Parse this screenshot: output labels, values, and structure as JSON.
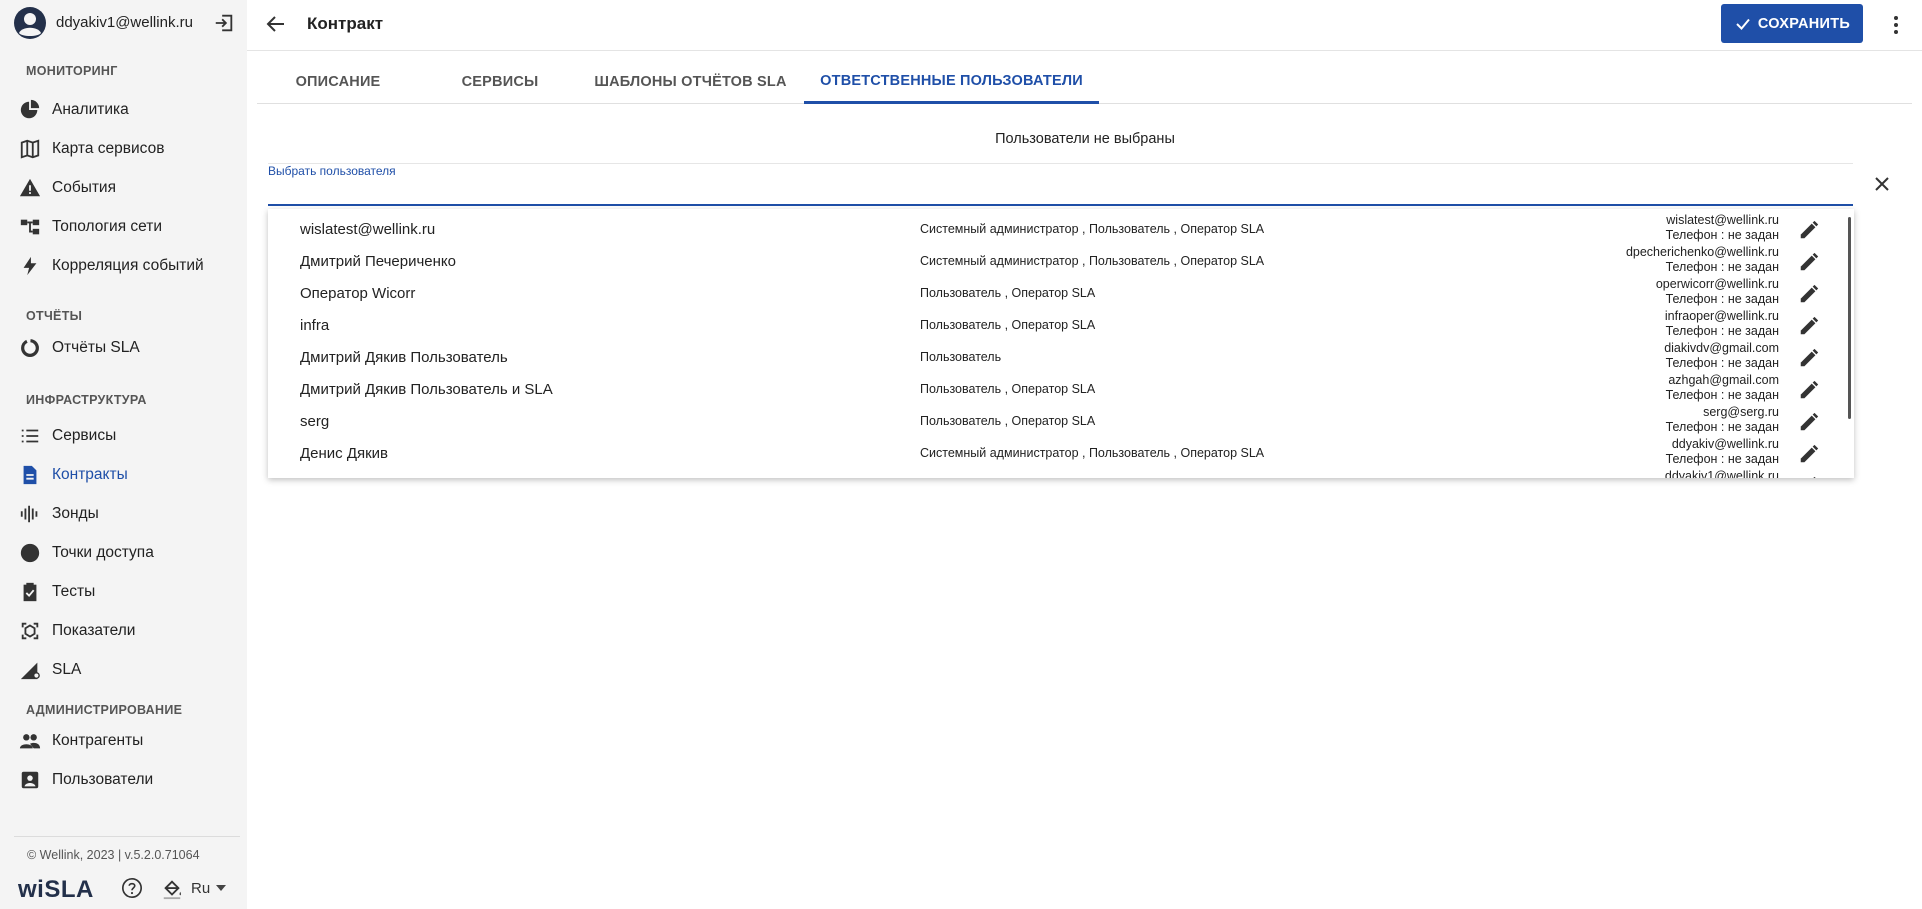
{
  "user": {
    "email": "ddyakiv1@wellink.ru"
  },
  "sidebar": {
    "sections": [
      {
        "title": "МОНИТОРИНГ",
        "items": [
          {
            "label": "Аналитика",
            "icon": "pie-chart-icon"
          },
          {
            "label": "Карта сервисов",
            "icon": "map-icon"
          },
          {
            "label": "События",
            "icon": "warning-icon"
          },
          {
            "label": "Топология сети",
            "icon": "topology-icon"
          },
          {
            "label": "Корреляция событий",
            "icon": "lightning-icon"
          }
        ]
      },
      {
        "title": "ОТЧЁТЫ",
        "items": [
          {
            "label": "Отчёты SLA",
            "icon": "donut-icon"
          }
        ]
      },
      {
        "title": "ИНФРАСТРУКТУРА",
        "items": [
          {
            "label": "Сервисы",
            "icon": "list-icon"
          },
          {
            "label": "Контракты",
            "icon": "document-icon",
            "active": true
          },
          {
            "label": "Зонды",
            "icon": "probe-icon"
          },
          {
            "label": "Точки доступа",
            "icon": "circle-icon"
          },
          {
            "label": "Тесты",
            "icon": "clipboard-check-icon"
          },
          {
            "label": "Показатели",
            "icon": "metrics-icon"
          },
          {
            "label": "SLA",
            "icon": "sla-icon"
          }
        ]
      },
      {
        "title": "АДМИНИСТРИРОВАНИЕ",
        "items": [
          {
            "label": "Контрагенты",
            "icon": "people-icon"
          },
          {
            "label": "Пользователи",
            "icon": "user-card-icon"
          }
        ]
      }
    ],
    "copyright": "© Wellink, 2023 | v.5.2.0.71064",
    "logo": "wiSLA",
    "language": "Ru"
  },
  "header": {
    "title": "Контракт",
    "save_label": "СОХРАНИТЬ"
  },
  "tabs": [
    {
      "label": "ОПИСАНИЕ"
    },
    {
      "label": "СЕРВИСЫ"
    },
    {
      "label": "ШАБЛОНЫ ОТЧЁТОВ SLA"
    },
    {
      "label": "ОТВЕТСТВЕННЫЕ ПОЛЬЗОВАТЕЛИ",
      "active": true
    }
  ],
  "main": {
    "empty_message": "Пользователи не выбраны",
    "select_label": "Выбрать пользователя",
    "select_value": ""
  },
  "dropdown": {
    "phone_text": "Телефон : не задан",
    "users": [
      {
        "name": "wislatest@wellink.ru",
        "roles": "Системный администратор ,  Пользователь ,  Оператор SLA",
        "email": "wislatest@wellink.ru"
      },
      {
        "name": "Дмитрий Печериченко",
        "roles": "Системный администратор ,  Пользователь ,  Оператор SLA",
        "email": "dpecherichenko@wellink.ru"
      },
      {
        "name": "Оператор Wicorr",
        "roles": "Пользователь ,  Оператор SLA",
        "email": "operwicorr@wellink.ru"
      },
      {
        "name": "infra",
        "roles": "Пользователь ,  Оператор SLA",
        "email": "infraoper@wellink.ru"
      },
      {
        "name": "Дмитрий Дякив Пользователь",
        "roles": "Пользователь",
        "email": "diakivdv@gmail.com"
      },
      {
        "name": "Дмитрий Дякив Пользователь и SLA",
        "roles": "Пользователь ,  Оператор SLA",
        "email": "azhgah@gmail.com"
      },
      {
        "name": "serg",
        "roles": "Пользователь ,  Оператор SLA",
        "email": "serg@serg.ru"
      },
      {
        "name": "Денис Дякив",
        "roles": "Системный администратор ,  Пользователь ,  Оператор SLA",
        "email": "ddyakiv@wellink.ru"
      },
      {
        "name": "",
        "roles": "",
        "email": "ddyakiv1@wellink.ru"
      }
    ]
  },
  "colors": {
    "accent": "#1f4fa8",
    "sidebar_bg": "#f4f4f4"
  }
}
